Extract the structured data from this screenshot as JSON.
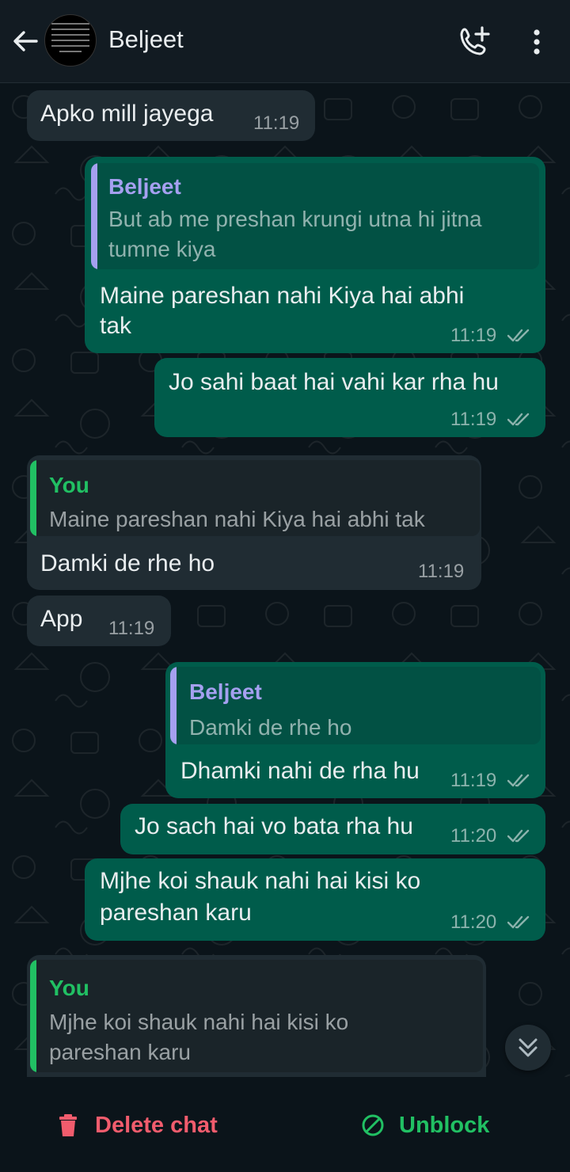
{
  "header": {
    "title": "Beljeet"
  },
  "colors": {
    "outgoing": "#005c4b",
    "incoming": "#202c33",
    "quote_contact": "#a5a0f0",
    "quote_you": "#21c063",
    "danger": "#f15c6d",
    "success": "#21c063"
  },
  "messages": [
    {
      "dir": "in",
      "text": "Apko mill jayega",
      "time": "11:19"
    },
    {
      "dir": "out",
      "quote_name": "Beljeet",
      "quote_lines": [
        "But ab me preshan  krungi utna hi jitna",
        "tumne kiya"
      ],
      "lines": [
        "Maine pareshan nahi Kiya hai abhi",
        "tak"
      ],
      "time": "11:19"
    },
    {
      "dir": "out",
      "text": "Jo sahi baat hai vahi kar rha hu",
      "time": "11:19"
    },
    {
      "dir": "in",
      "quote_name": "You",
      "quote_text": "Maine pareshan nahi Kiya hai abhi tak",
      "text": "Damki de rhe ho",
      "time": "11:19"
    },
    {
      "dir": "in",
      "text": "App",
      "time": "11:19"
    },
    {
      "dir": "out",
      "quote_name": "Beljeet",
      "quote_text": "Damki de rhe ho",
      "text": "Dhamki nahi de rha hu",
      "time": "11:19"
    },
    {
      "dir": "out",
      "text": "Jo sach hai vo bata rha hu",
      "time": "11:20"
    },
    {
      "dir": "out",
      "lines": [
        "Mjhe koi shauk nahi hai kisi ko",
        "pareshan karu"
      ],
      "time": "11:20"
    },
    {
      "dir": "in",
      "quote_name": "You",
      "quote_lines": [
        "Mjhe koi shauk nahi hai kisi ko",
        "pareshan karu"
      ]
    }
  ],
  "footer": {
    "delete_label": "Delete chat",
    "unblock_label": "Unblock"
  },
  "icons": {
    "back": "arrow-left-icon",
    "call": "add-call-icon",
    "more": "more-vert-icon",
    "delete": "trash-icon",
    "unblock": "unblock-icon",
    "scroll": "double-chevron-down-icon"
  }
}
